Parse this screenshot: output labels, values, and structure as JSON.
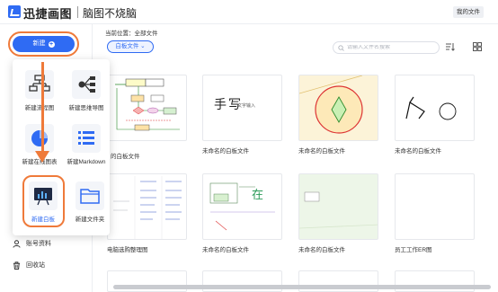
{
  "header": {
    "brand": "迅捷画图",
    "slogan": "脑图不烧脑",
    "my_files": "我的文件"
  },
  "sidebar": {
    "new_button": "新建",
    "items": [
      {
        "label": "账号资料",
        "icon": "user-icon"
      },
      {
        "label": "回收站",
        "icon": "trash-icon"
      }
    ]
  },
  "new_menu": {
    "items": [
      {
        "label": "新建流程图",
        "icon": "flowchart-icon"
      },
      {
        "label": "新建思维导图",
        "icon": "mindmap-icon"
      },
      {
        "label": "新建在线图表",
        "icon": "pie-chart-icon"
      },
      {
        "label": "新建Markdown",
        "icon": "markdown-icon"
      },
      {
        "label": "新建白板",
        "icon": "whiteboard-icon"
      },
      {
        "label": "新建文件夹",
        "icon": "folder-icon"
      }
    ]
  },
  "main": {
    "breadcrumb": "当前位置：全部文件",
    "filter": "白板文件",
    "search_placeholder": "请输入文件名搜索",
    "files": [
      {
        "name": ""
      },
      {
        "name": "未命名的白板文件"
      },
      {
        "name": "未命名的白板文件"
      },
      {
        "name": "未命名的白板文件"
      },
      {
        "name": "电脑选购整理图"
      },
      {
        "name": "未命名的白板文件"
      },
      {
        "name": "未命名的白板文件"
      },
      {
        "name": "员工工作ER图"
      }
    ],
    "thumb_texts": {
      "handwriting": "手写",
      "text_input": "文字输入",
      "zai": "在"
    },
    "partial_caption": "的白板文件"
  },
  "colors": {
    "accent": "#2f6bf3",
    "highlight": "#ef7a3a"
  }
}
